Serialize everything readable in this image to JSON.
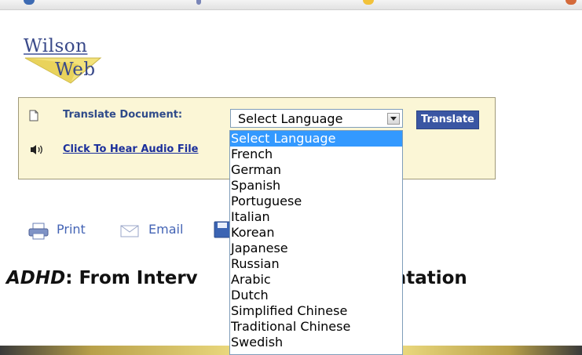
{
  "logo": {
    "line1": "Wilson",
    "line2": "Web"
  },
  "translate_panel": {
    "label": "Translate Document:",
    "audio_link": "Click To Hear Audio File",
    "select_value": "Select Language",
    "translate_button": "Translate"
  },
  "actions": {
    "print": "Print",
    "email": "Email"
  },
  "article": {
    "title_part1": "ADHD",
    "title_part2": ": From Interv",
    "title_part3": "ementation"
  },
  "dropdown": {
    "options": [
      "Select Language",
      "French",
      "German",
      "Spanish",
      "Portuguese",
      "Italian",
      "Korean",
      "Japanese",
      "Russian",
      "Arabic",
      "Dutch",
      "Simplified Chinese",
      "Traditional Chinese",
      "Swedish"
    ],
    "selected_index": 0
  },
  "colors": {
    "panel_bg": "#fbf6d6",
    "link_blue": "#1b2f9b",
    "button_blue": "#3a56a3",
    "selection_blue": "#3399ff"
  }
}
